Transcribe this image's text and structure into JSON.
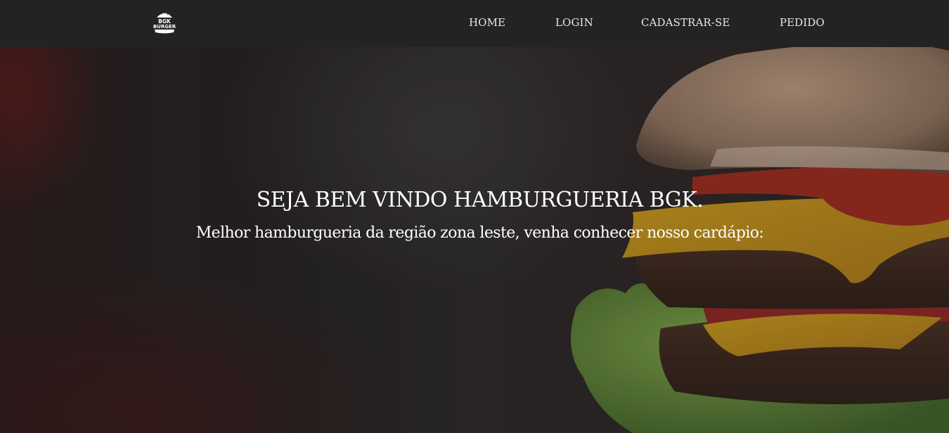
{
  "brand": {
    "logo_line1": "BGK",
    "logo_line2": "BURGER",
    "icon": "burger-logo-icon"
  },
  "nav": {
    "items": [
      {
        "label": "HOME"
      },
      {
        "label": "LOGIN"
      },
      {
        "label": "CADASTRAR-SE"
      },
      {
        "label": "PEDIDO"
      }
    ]
  },
  "hero": {
    "title": "SEJA BEM VINDO HAMBURGUERIA BGK.",
    "subtitle": "Melhor hamburgueria da região zona leste, venha conhecer nosso cardápio:",
    "background_image": "burger-photo"
  },
  "colors": {
    "navbar_bg": "#242323",
    "nav_text": "#e9e6e6",
    "hero_text": "#ffffff"
  }
}
